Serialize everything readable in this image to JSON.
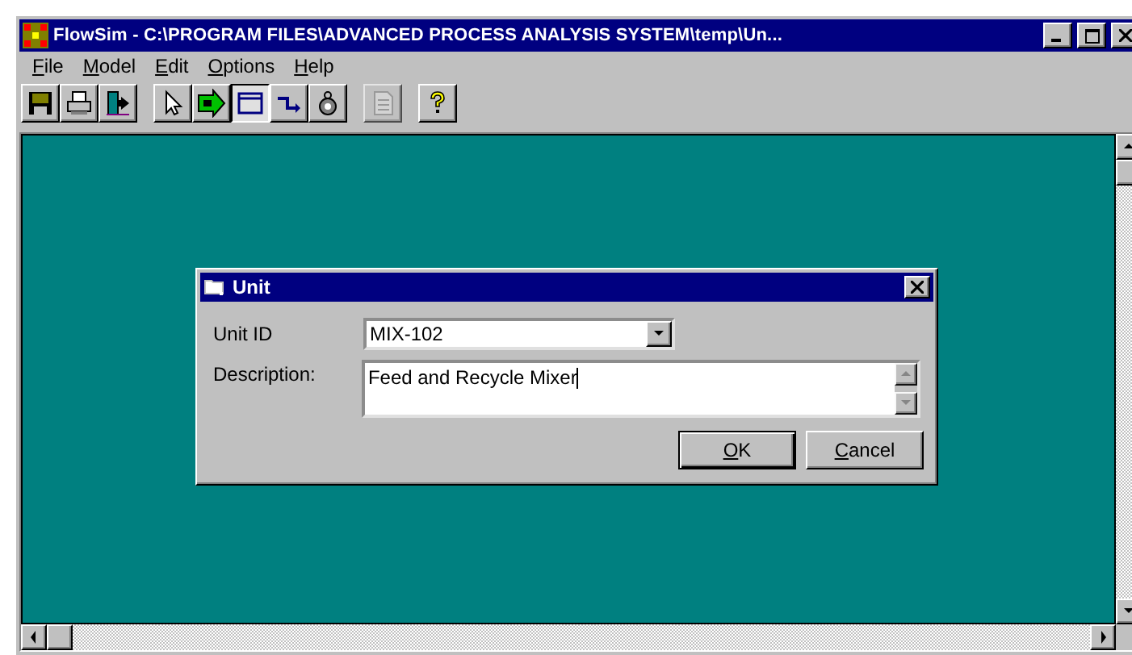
{
  "window": {
    "title": "FlowSim - C:\\PROGRAM FILES\\ADVANCED PROCESS ANALYSIS SYSTEM\\temp\\Un..."
  },
  "menu": [
    {
      "label": "File",
      "mnemonic_first": true
    },
    {
      "label": "Model",
      "mnemonic_first": true
    },
    {
      "label": "Edit",
      "mnemonic_first": true
    },
    {
      "label": "Options",
      "mnemonic_first": true
    },
    {
      "label": "Help",
      "mnemonic_first": true
    }
  ],
  "toolbar": [
    {
      "kind": "save",
      "selected": false,
      "disabled": false
    },
    {
      "kind": "print",
      "selected": false,
      "disabled": false
    },
    {
      "kind": "exit",
      "selected": false,
      "disabled": false
    },
    {
      "kind": "separator"
    },
    {
      "kind": "pointer",
      "selected": false,
      "disabled": false
    },
    {
      "kind": "arrow",
      "selected": false,
      "disabled": false
    },
    {
      "kind": "unit",
      "selected": true,
      "disabled": false
    },
    {
      "kind": "stream",
      "selected": false,
      "disabled": false
    },
    {
      "kind": "bag",
      "selected": false,
      "disabled": false
    },
    {
      "kind": "separator"
    },
    {
      "kind": "document",
      "selected": false,
      "disabled": true
    },
    {
      "kind": "separator"
    },
    {
      "kind": "help",
      "selected": false,
      "disabled": false
    }
  ],
  "dialog": {
    "title": "Unit",
    "unit_id": {
      "label": "Unit ID",
      "value": "MIX-102"
    },
    "description": {
      "label": "Description:",
      "value": "Feed and Recycle Mixer"
    },
    "buttons": [
      {
        "label": "OK",
        "mnemonic_first": true,
        "default": true
      },
      {
        "label": "Cancel",
        "mnemonic_first": true,
        "default": false
      }
    ]
  }
}
